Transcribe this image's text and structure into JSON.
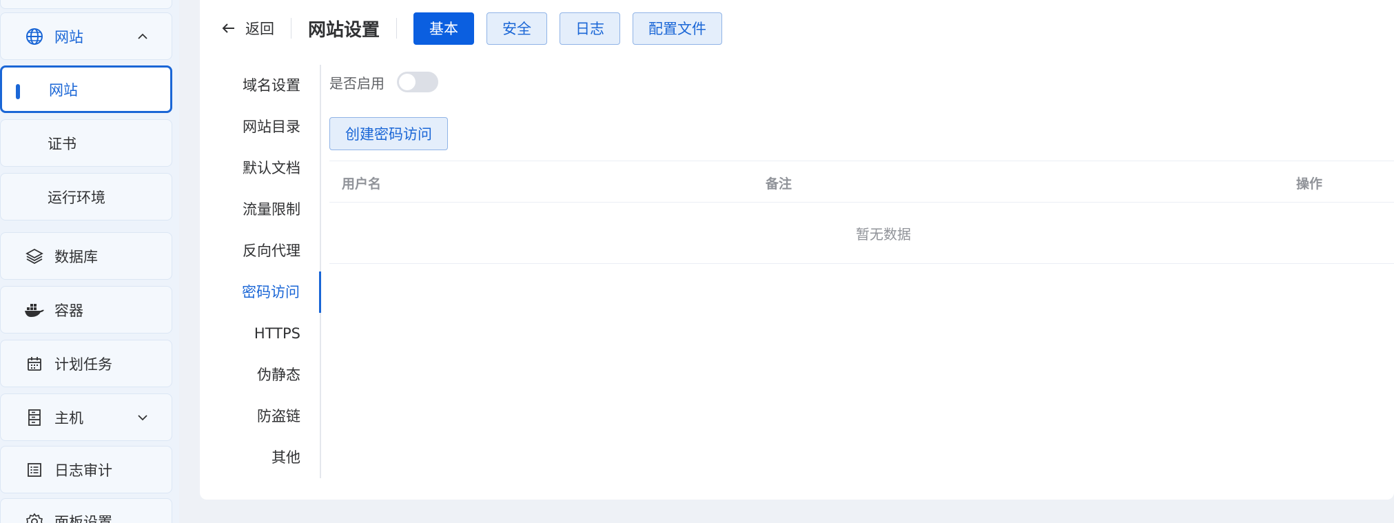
{
  "sidebar": {
    "items": [
      {
        "label": "网站",
        "icon": "globe-icon",
        "expanded": true
      },
      {
        "label": "网站",
        "selected": true
      },
      {
        "label": "证书"
      },
      {
        "label": "运行环境"
      },
      {
        "label": "数据库",
        "icon": "layers-icon"
      },
      {
        "label": "容器",
        "icon": "docker-icon"
      },
      {
        "label": "计划任务",
        "icon": "calendar-icon"
      },
      {
        "label": "主机",
        "icon": "server-icon",
        "expanded": false
      },
      {
        "label": "日志审计",
        "icon": "log-icon"
      },
      {
        "label": "面板设置",
        "icon": "gear-icon"
      }
    ]
  },
  "header": {
    "back_label": "返回",
    "title": "网站设置",
    "tabs": [
      {
        "label": "基本",
        "active": true
      },
      {
        "label": "安全"
      },
      {
        "label": "日志"
      },
      {
        "label": "配置文件"
      }
    ]
  },
  "side_tabs": [
    "域名设置",
    "网站目录",
    "默认文档",
    "流量限制",
    "反向代理",
    "密码访问",
    "HTTPS",
    "伪静态",
    "防盗链",
    "其他"
  ],
  "active_side_tab": "密码访问",
  "content": {
    "enable_label": "是否启用",
    "enabled": false,
    "create_button": "创建密码访问",
    "table": {
      "columns": [
        "用户名",
        "备注",
        "操作"
      ],
      "rows": [],
      "empty_text": "暂无数据"
    }
  },
  "colors": {
    "accent": "#1a66d6",
    "primary_button": "#0b5fe0",
    "background": "#eef1f6"
  }
}
